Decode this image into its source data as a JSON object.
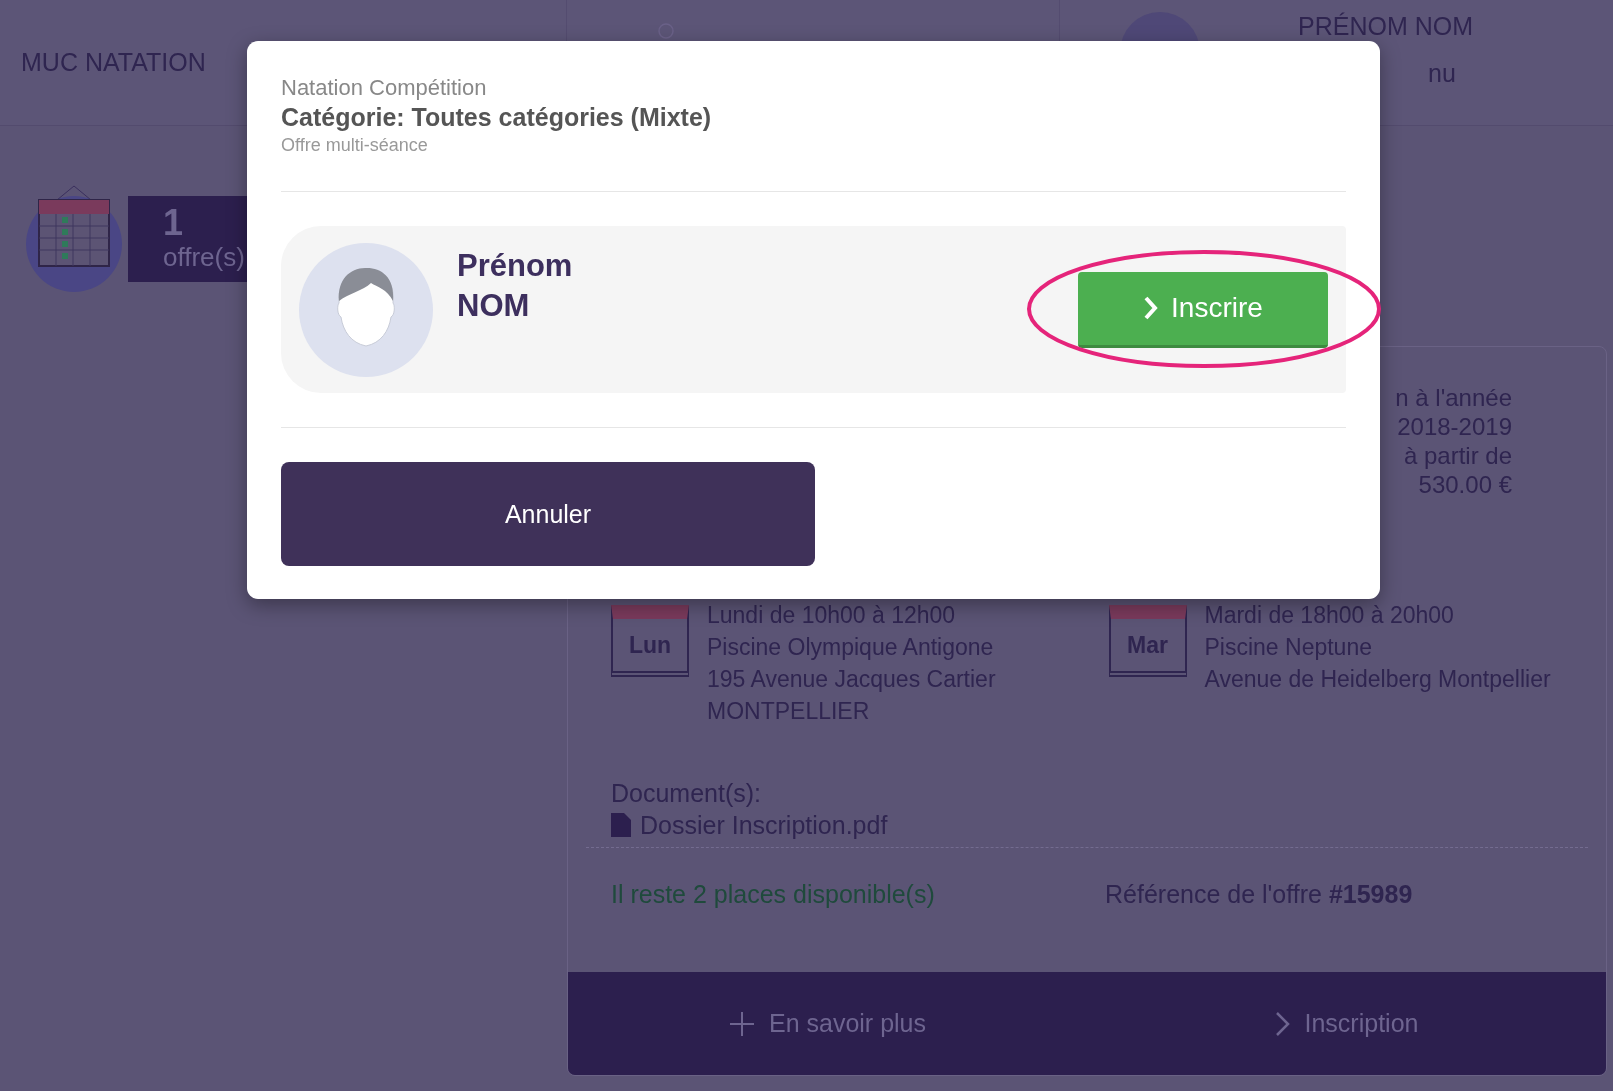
{
  "header": {
    "brand": "MUC NATATION",
    "user_name": "PRÉNOM NOM",
    "menu_label": "nu"
  },
  "offers_badge": {
    "count": "1",
    "label": "offre(s)"
  },
  "offer_card": {
    "price_lines": [
      "n à l'année",
      "2018-2019",
      "à partir de",
      "530.00 €"
    ],
    "sessions": [
      {
        "day": "Lun",
        "lines": [
          "Lundi de 10h00 à 12h00",
          "Piscine Olympique Antigone",
          "195 Avenue Jacques Cartier",
          "MONTPELLIER"
        ]
      },
      {
        "day": "Mar",
        "lines": [
          "Mardi de 18h00 à 20h00",
          "Piscine Neptune",
          "Avenue de Heidelberg Montpellier"
        ]
      }
    ],
    "documents_label": "Document(s):",
    "documents": [
      "Dossier Inscription.pdf"
    ],
    "availability": "Il reste 2 places disponible(s)",
    "reference": "Référence de l'offre **#15989**",
    "actions": [
      {
        "kind": "more",
        "label": "En savoir plus"
      },
      {
        "kind": "next",
        "label": "Inscription"
      }
    ]
  },
  "modal": {
    "activity": "Natation Compétition",
    "category": "Catégorie: Toutes catégories (Mixte)",
    "offer_type": "Offre multi-séance",
    "member": {
      "first_name": "Prénom",
      "last_name": "NOM"
    },
    "primary_button": "Inscrire",
    "cancel_button": "Annuler"
  }
}
